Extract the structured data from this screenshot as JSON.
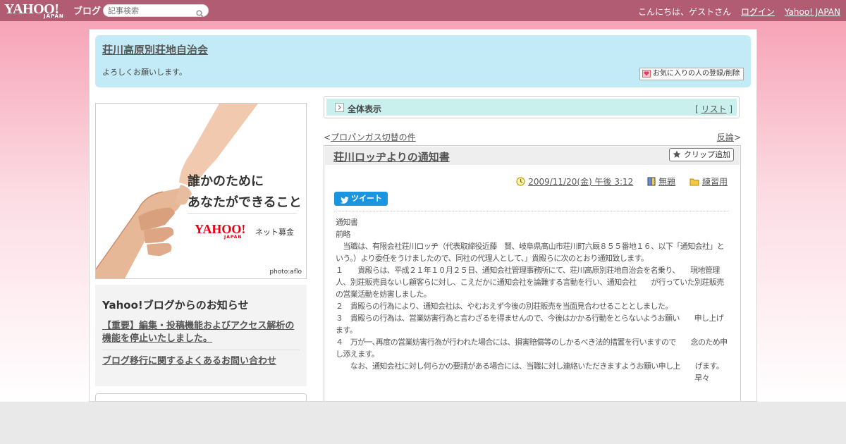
{
  "topbar": {
    "brand_yahoo": "YAHOO!",
    "brand_japan": "JAPAN",
    "brand_blog": "ブログ",
    "search_placeholder": "記事検索",
    "greeting": "こんにちは、ゲストさん",
    "login": "ログイン",
    "yahoo_japan": "Yahoo! JAPAN"
  },
  "blog": {
    "title": "荘川高原別荘地自治会",
    "description": "よろしくお願いします。",
    "favorite_button": "お気に入りの人の登録/削除"
  },
  "banner": {
    "line1": "誰かのために",
    "line2": "あなたができること",
    "logo_yahoo": "YAHOO!",
    "logo_japan": "JAPAN",
    "logo_service": "ネット募金",
    "photo_credit": "photo:aflo"
  },
  "notice": {
    "heading": "Yahoo!ブログからのお知らせ",
    "item1": "【重要】編集・投稿機能およびアクセス解析の機能を停止いたしました。",
    "item2": "ブログ移行に関するよくあるお問い合わせ"
  },
  "category": {
    "label": "全体表示",
    "list_prefix": "[ ",
    "list_label": "リスト",
    "list_suffix": " ]"
  },
  "nav": {
    "prev_bracket": "<",
    "prev": "プロパンガス切替の件",
    "next": "反論",
    "next_bracket": ">"
  },
  "article": {
    "title": "荘川ロッヂよりの通知書",
    "clip_button": "クリップ追加",
    "date": "2009/11/20(金) 午後 3:12",
    "theme": "無題",
    "category": "練習用",
    "tweet": "ツイート",
    "body": [
      "通知書",
      "前略",
      "　当職は、有限会社荘川ロッヂ（代表取締役近藤　賢、岐阜県高山市荘川町六厩８５５番地１６、以下「通知会社」という。）より委任をうけましたので、同社の代理人として、」貴殿らに次のとおり通知致します。",
      "１　　貴殿らは、平成２１年１０月２５日、通知会社管理事務所にて、荘川高原別荘地自治会を名乗り、　　現地管理人、別荘販売員ないし顧客らに対し、こえだかに通知会社を論難する言動を行い、通知会社　　が行っていた別荘販売の営業活動を妨害しました。",
      "２　貴殿らの行為により、通知会社は、やむおえず今後の別荘販売を当面見合わせることとしました。",
      "３　貴殿らの行為は、営業妨害行為と言わざるを得ませんので、今後はかかる行動をとらないようお願い　　申し上げます。",
      "４　万が一､再度の営業妨害行為が行われた場合には、損害賠償等のしかるべき法的措置を行いますので　　念のため申し添えます。",
      "　　なお、通知会社に対し何らかの要請がある場合には、当職に対し連絡いただきますようお願い申し上　　げます。"
    ],
    "closing": "早々"
  },
  "colors": {
    "topbar": "#b15c72",
    "header": "#c3ebf7",
    "category_bar": "#c9f0ec",
    "tweet": "#1b95e0"
  }
}
